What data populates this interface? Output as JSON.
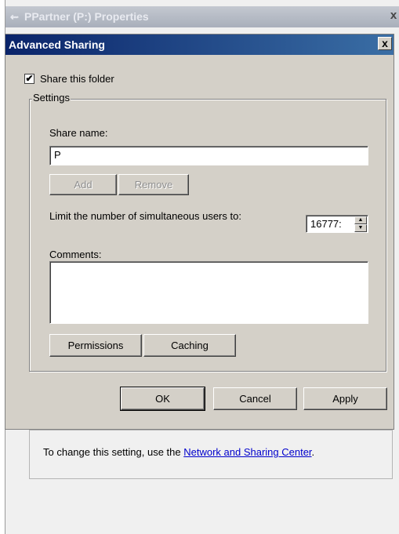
{
  "background_window": {
    "title": "PPartner (P:) Properties",
    "close_glyph": "x",
    "info_prefix": "To change this setting, use the ",
    "info_link": "Network and Sharing Center",
    "info_suffix": "."
  },
  "dialog": {
    "title": "Advanced Sharing",
    "close_glyph": "x",
    "share_checkbox": {
      "label": "Share this folder",
      "checked": true,
      "mark": "✔"
    },
    "settings": {
      "legend": "Settings",
      "share_name_label": "Share name:",
      "share_name_value": "P",
      "add_label": "Add",
      "remove_label": "Remove",
      "limit_label": "Limit the number of simultaneous users to:",
      "limit_value": "16777:",
      "comments_label": "Comments:",
      "comments_value": "",
      "permissions_label": "Permissions",
      "caching_label": "Caching"
    },
    "buttons": {
      "ok": "OK",
      "cancel": "Cancel",
      "apply": "Apply"
    }
  },
  "icons": {
    "window": "drive-icon",
    "spin_up": "spin-up-arrow-icon",
    "spin_down": "spin-down-arrow-icon"
  }
}
